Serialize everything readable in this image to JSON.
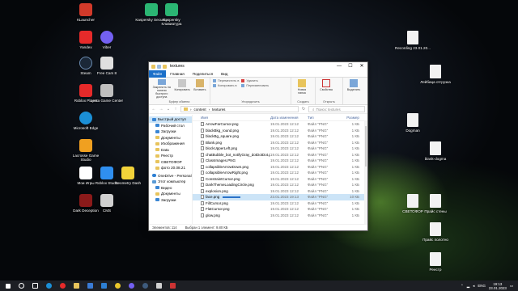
{
  "desktop_icons": [
    {
      "label": "КLauncher",
      "color": "#d23a2a"
    },
    {
      "label": "Kaspersky Security",
      "color": "#2bb673"
    },
    {
      "label": "Kaspersky Клавиатура",
      "color": "#2bb673"
    },
    {
      "label": "Yandex",
      "color": "#e62a2a"
    },
    {
      "label": "Viber",
      "color": "#7360f2"
    },
    {
      "label": "Steam",
      "color": "#1b2838"
    },
    {
      "label": "Free Cam 8",
      "color": "#e0e0e0"
    },
    {
      "label": "Roblox Player",
      "color": "#e62a2a"
    },
    {
      "label": "Lesta Game Center",
      "color": "#bfbfbf"
    },
    {
      "label": "Microsoft Edge",
      "color": "#1b8fd6"
    },
    {
      "label": "Lacrosse Game Studio",
      "color": "#f0a020"
    },
    {
      "label": "Мои Игры",
      "color": "#ffffff"
    },
    {
      "label": "Roblox Studio",
      "color": "#2f8ff0"
    },
    {
      "label": "Geometry Dash",
      "color": "#f2d33a"
    },
    {
      "label": "Dark Deception",
      "color": "#8b1a1a"
    },
    {
      "label": "CMS",
      "color": "#d0d0d0"
    },
    {
      "label": "Recording 23.01.20...",
      "color": "#f2f2f2"
    },
    {
      "label": "Лейбица отгрузка",
      "color": "#f2f2f2"
    },
    {
      "label": "Dogman",
      "color": "#f2f2f2"
    },
    {
      "label": "blank-dogma",
      "color": "#f2f2f2"
    },
    {
      "label": "СВЕТОФОР",
      "color": "#f2f2f2"
    },
    {
      "label": "Прайс стены",
      "color": "#f2f2f2"
    },
    {
      "label": "Прайс полотно",
      "color": "#f2f2f2"
    },
    {
      "label": "Реестр",
      "color": "#f2f2f2"
    }
  ],
  "window": {
    "title": "textures",
    "minimize": "—",
    "maximize": "☐",
    "close": "✕",
    "ribbon_tabs": [
      "Файл",
      "Главная",
      "Поделиться",
      "Вид"
    ],
    "ribbon": {
      "pin_label": "Закрепить на панели быстрого доступа",
      "copy_label": "Копировать",
      "paste_label": "Вставить",
      "clipboard_caption": "Буфер обмена",
      "move_label": "Переместить в",
      "copy_to_label": "Копировать в",
      "delete_label": "Удалить",
      "rename_label": "Переименовать",
      "organize_caption": "Упорядочить",
      "new_folder_label": "Новая папка",
      "create_caption": "Создать",
      "properties_label": "Свойства",
      "open_caption": "Открыть",
      "select_label": "Выделить"
    },
    "address": {
      "segments": [
        "content",
        "textures"
      ],
      "search_placeholder": "Поиск: textures"
    },
    "nav_items": [
      {
        "label": "Быстрый доступ",
        "icon": "star-icon",
        "level": 1,
        "selected": true
      },
      {
        "label": "Рабочий стол",
        "icon": "desktop-folder-icon",
        "level": 2
      },
      {
        "label": "Загрузки",
        "icon": "download-folder-icon",
        "level": 2
      },
      {
        "label": "Документы",
        "icon": "documents-folder-icon",
        "level": 2
      },
      {
        "label": "Изображения",
        "icon": "pictures-folder-icon",
        "level": 2
      },
      {
        "label": "Data",
        "icon": "folder-icon",
        "level": 2
      },
      {
        "label": "Реестр",
        "icon": "folder-icon",
        "level": 2
      },
      {
        "label": "СВЕТОФОР",
        "icon": "folder-icon",
        "level": 2
      },
      {
        "label": "фото 20.08.21",
        "icon": "folder-icon",
        "level": 2
      },
      {
        "label": "OneDrive - Personal",
        "icon": "cloud-icon",
        "level": 1
      },
      {
        "label": "Этот компьютер",
        "icon": "pc-icon",
        "level": 1
      },
      {
        "label": "Видео",
        "icon": "video-folder-icon",
        "level": 2
      },
      {
        "label": "Документы",
        "icon": "documents-folder-icon",
        "level": 2
      },
      {
        "label": "Загрузки",
        "icon": "download-folder-icon",
        "level": 2
      }
    ],
    "columns": [
      "Имя",
      "Дата изменения",
      "Тип",
      "Размер"
    ],
    "files": [
      {
        "name": "ArrowFarCursor.png",
        "date": "19.01.2023 12:12",
        "type": "Файл \"PNG\"",
        "size": "1 КБ"
      },
      {
        "name": "blackBkg_round.png",
        "date": "19.01.2023 12:12",
        "type": "Файл \"PNG\"",
        "size": "1 КБ"
      },
      {
        "name": "blackBg_square.png",
        "date": "19.01.2023 12:12",
        "type": "Файл \"PNG\"",
        "size": "1 КБ"
      },
      {
        "name": "Blank.png",
        "date": "19.01.2023 12:12",
        "type": "Файл \"PNG\"",
        "size": "1 КБ"
      },
      {
        "name": "blockUpperLeft.png",
        "date": "19.01.2023 12:12",
        "type": "Файл \"PNG\"",
        "size": "1 КБ"
      },
      {
        "name": "chatBubble_bot_notifyGray_dotDotDot.p...",
        "date": "19.01.2023 12:12",
        "type": "Файл \"PNG\"",
        "size": "1 КБ"
      },
      {
        "name": "ClassImages.PNG",
        "date": "19.01.2023 12:12",
        "type": "Файл \"PNG\"",
        "size": "1 КБ"
      },
      {
        "name": "collapsibleArrowDown.png",
        "date": "19.01.2023 12:12",
        "type": "Файл \"PNG\"",
        "size": "1 КБ"
      },
      {
        "name": "collapsibleArrowRight.png",
        "date": "19.01.2023 12:12",
        "type": "Файл \"PNG\"",
        "size": "1 КБ"
      },
      {
        "name": "ConstraintCursor.png",
        "date": "19.01.2023 12:12",
        "type": "Файл \"PNG\"",
        "size": "1 КБ"
      },
      {
        "name": "DarkThemeLoadingCircle.png",
        "date": "19.01.2023 12:12",
        "type": "Файл \"PNG\"",
        "size": "1 КБ"
      },
      {
        "name": "explosion.png",
        "date": "19.01.2023 12:12",
        "type": "Файл \"PNG\"",
        "size": "1 КБ"
      },
      {
        "name": "face.png",
        "date": "23.01.2023 19:13",
        "type": "Файл \"PNG\"",
        "size": "10 КБ",
        "selected": true
      },
      {
        "name": "FillCursor.png",
        "date": "19.01.2023 12:12",
        "type": "Файл \"PNG\"",
        "size": "1 КБ"
      },
      {
        "name": "FlatCursor.png",
        "date": "19.01.2023 12:12",
        "type": "Файл \"PNG\"",
        "size": "1 КБ"
      },
      {
        "name": "glow.png",
        "date": "19.01.2023 12:12",
        "type": "Файл \"PNG\"",
        "size": "1 КБ"
      }
    ],
    "status": {
      "count": "Элементов: 114",
      "selection": "Выбран 1 элемент: 9,80 КБ"
    }
  },
  "taskbar": {
    "apps": [
      "start-icon",
      "search-icon",
      "task-view-icon",
      "edge-icon",
      "yandex-icon",
      "explorer-icon",
      "store-icon",
      "mail-icon",
      "chrome-icon",
      "viber-icon",
      "steam-icon",
      "roblox-icon",
      "camera-icon"
    ],
    "language": "ENG",
    "time": "19:13",
    "date": "23.01.2023"
  }
}
